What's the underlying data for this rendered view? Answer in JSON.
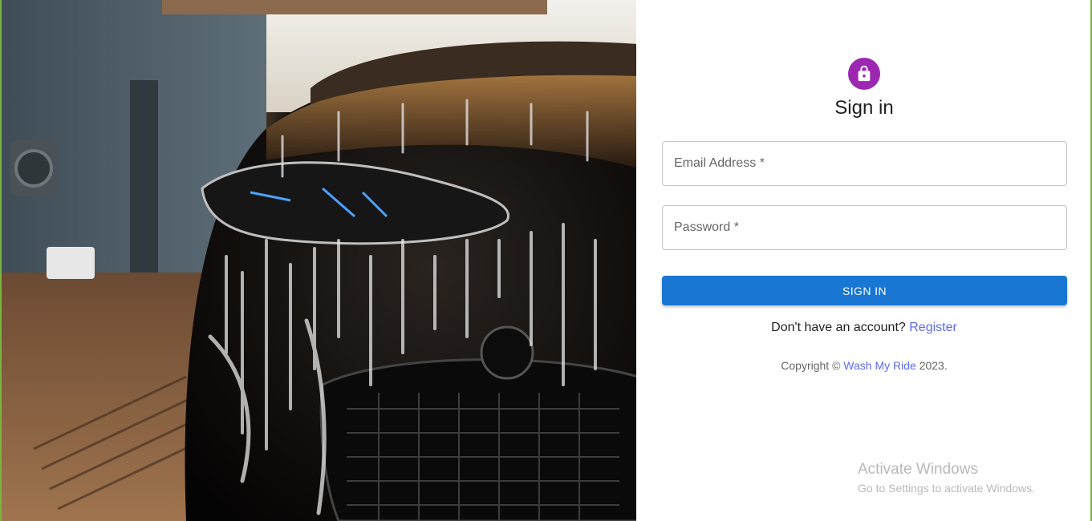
{
  "hero": {
    "image_description_icon": "car-wash-photo"
  },
  "auth": {
    "avatar_icon": "lock-icon",
    "title": "Sign in",
    "email_label": "Email Address *",
    "password_label": "Password *",
    "submit_label": "SIGN IN",
    "register_prompt": "Don't have an account?",
    "register_link": "Register",
    "copyright_prefix": "Copyright ©",
    "brand_link": "Wash My Ride",
    "copyright_suffix": "2023."
  },
  "colors": {
    "avatar_bg": "#9c27b0",
    "primary": "#1976d2",
    "link": "#5c6bf0",
    "border_accent": "#7cb342"
  },
  "watermark": {
    "line1": "Activate Windows",
    "line2": "Go to Settings to activate Windows."
  }
}
